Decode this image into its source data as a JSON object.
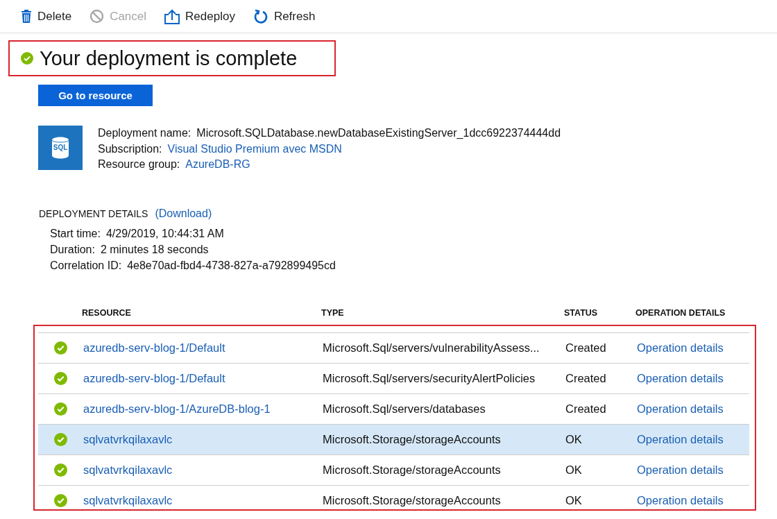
{
  "toolbar": [
    {
      "kind": "delete",
      "label": "Delete",
      "disabled": false
    },
    {
      "kind": "cancel",
      "label": "Cancel",
      "disabled": true
    },
    {
      "kind": "redeploy",
      "label": "Redeploy",
      "disabled": false
    },
    {
      "kind": "refresh",
      "label": "Refresh",
      "disabled": false
    }
  ],
  "heading": {
    "title": "Your deployment is complete",
    "highlighted": true
  },
  "primary_button": "Go to resource",
  "summary": {
    "icon_text": "SQL",
    "fields": [
      {
        "label": "Deployment name:",
        "value": "Microsoft.SQLDatabase.newDatabaseExistingServer_1dcc6922374444dd",
        "kind": "text"
      },
      {
        "label": "Subscription:",
        "value": "Visual Studio Premium avec MSDN",
        "kind": "link"
      },
      {
        "label": "Resource group:",
        "value": "AzureDB-RG",
        "kind": "link"
      }
    ]
  },
  "details": {
    "title": "DEPLOYMENT DETAILS",
    "download_link": "(Download)",
    "fields": [
      {
        "label": "Start time:",
        "value": "4/29/2019, 10:44:31 AM"
      },
      {
        "label": "Duration:",
        "value": "2 minutes 18 seconds"
      },
      {
        "label": "Correlation ID:",
        "value": "4e8e70ad-fbd4-4738-827a-a792899495cd"
      }
    ]
  },
  "table": {
    "highlighted": true,
    "columns": [
      "RESOURCE",
      "TYPE",
      "STATUS",
      "OPERATION DETAILS"
    ],
    "rows": [
      {
        "resource": "azuredb-serv-blog-1/Default",
        "type": "Microsoft.Sql/servers/vulnerabilityAssess...",
        "status": "Created",
        "operation": "Operation details",
        "selected": false
      },
      {
        "resource": "azuredb-serv-blog-1/Default",
        "type": "Microsoft.Sql/servers/securityAlertPolicies",
        "status": "Created",
        "operation": "Operation details",
        "selected": false
      },
      {
        "resource": "azuredb-serv-blog-1/AzureDB-blog-1",
        "type": "Microsoft.Sql/servers/databases",
        "status": "Created",
        "operation": "Operation details",
        "selected": false
      },
      {
        "resource": "sqlvatvrkqilaxavlc",
        "type": "Microsoft.Storage/storageAccounts",
        "status": "OK",
        "operation": "Operation details",
        "selected": true
      },
      {
        "resource": "sqlvatvrkqilaxavlc",
        "type": "Microsoft.Storage/storageAccounts",
        "status": "OK",
        "operation": "Operation details",
        "selected": false
      },
      {
        "resource": "sqlvatvrkqilaxavlc",
        "type": "Microsoft.Storage/storageAccounts",
        "status": "OK",
        "operation": "Operation details",
        "selected": false
      }
    ]
  }
}
